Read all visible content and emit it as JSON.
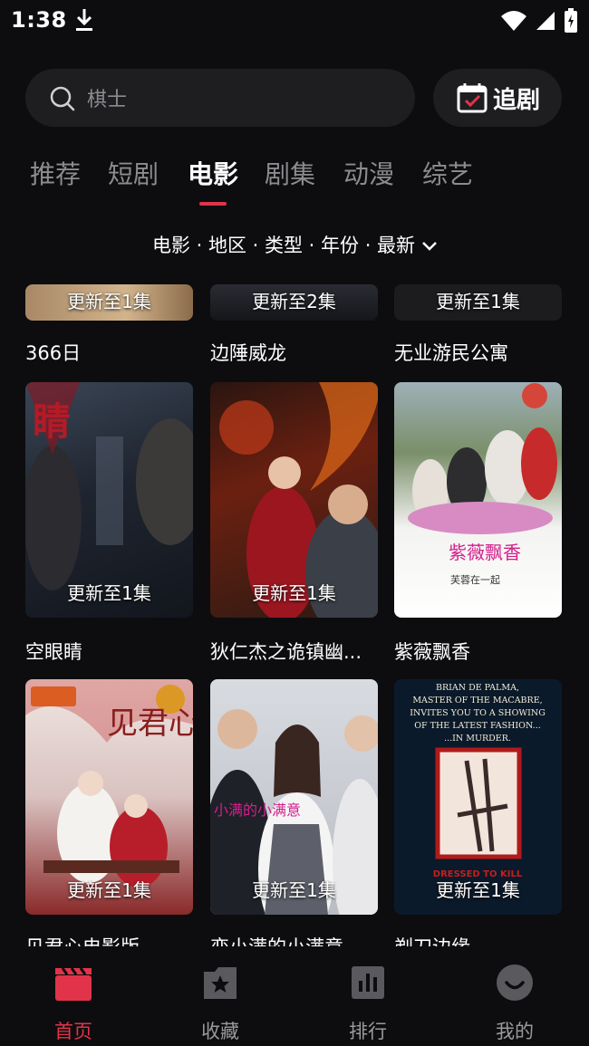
{
  "status_bar": {
    "time": "1:38"
  },
  "search": {
    "placeholder": "棋士",
    "follow_label": "追剧"
  },
  "tabs": [
    {
      "label": "推荐",
      "active": false
    },
    {
      "label": "短剧",
      "active": false
    },
    {
      "label": "电影",
      "active": true
    },
    {
      "label": "剧集",
      "active": false
    },
    {
      "label": "动漫",
      "active": false
    },
    {
      "label": "综艺",
      "active": false
    }
  ],
  "filter": {
    "text": "电影 · 地区 · 类型 · 年份 · 最新"
  },
  "rows": [
    [
      {
        "title": "366日",
        "episode": "更新至1集"
      },
      {
        "title": "边陲威龙",
        "episode": "更新至2集"
      },
      {
        "title": "无业游民公寓",
        "episode": "更新至1集"
      }
    ],
    [
      {
        "title": "空眼睛",
        "episode": "更新至1集"
      },
      {
        "title": "狄仁杰之诡镇幽...",
        "episode": "更新至1集"
      },
      {
        "title": "紫薇飘香",
        "episode": "更新至1集"
      }
    ],
    [
      {
        "title": "见君心电影版",
        "episode": "更新至1集"
      },
      {
        "title": "恋小满的小满意",
        "episode": "更新至1集"
      },
      {
        "title": "剃刀边缘",
        "episode": "更新至1集"
      }
    ]
  ],
  "posters": {
    "p4_text": "睛",
    "p6_title": "紫薇飘香",
    "p6_sub": "芙蓉在一起",
    "p7_title": "见君心",
    "p8_title": "小满的小满意",
    "p9_lines": [
      "BRIAN DE PALMA,",
      "MASTER OF THE MACABRE,",
      "INVITES YOU TO A SHOWING",
      "OF THE LATEST FASHION...",
      "...IN MURDER.",
      "DRESSED TO KILL"
    ]
  },
  "nav": [
    {
      "label": "首页",
      "icon": "clapperboard-icon",
      "active": true
    },
    {
      "label": "收藏",
      "icon": "star-box-icon",
      "active": false
    },
    {
      "label": "排行",
      "icon": "bar-chart-icon",
      "active": false
    },
    {
      "label": "我的",
      "icon": "smile-face-icon",
      "active": false
    }
  ],
  "colors": {
    "accent": "#e1344a",
    "background": "#0d0d0f",
    "surface": "#1e1e21"
  }
}
